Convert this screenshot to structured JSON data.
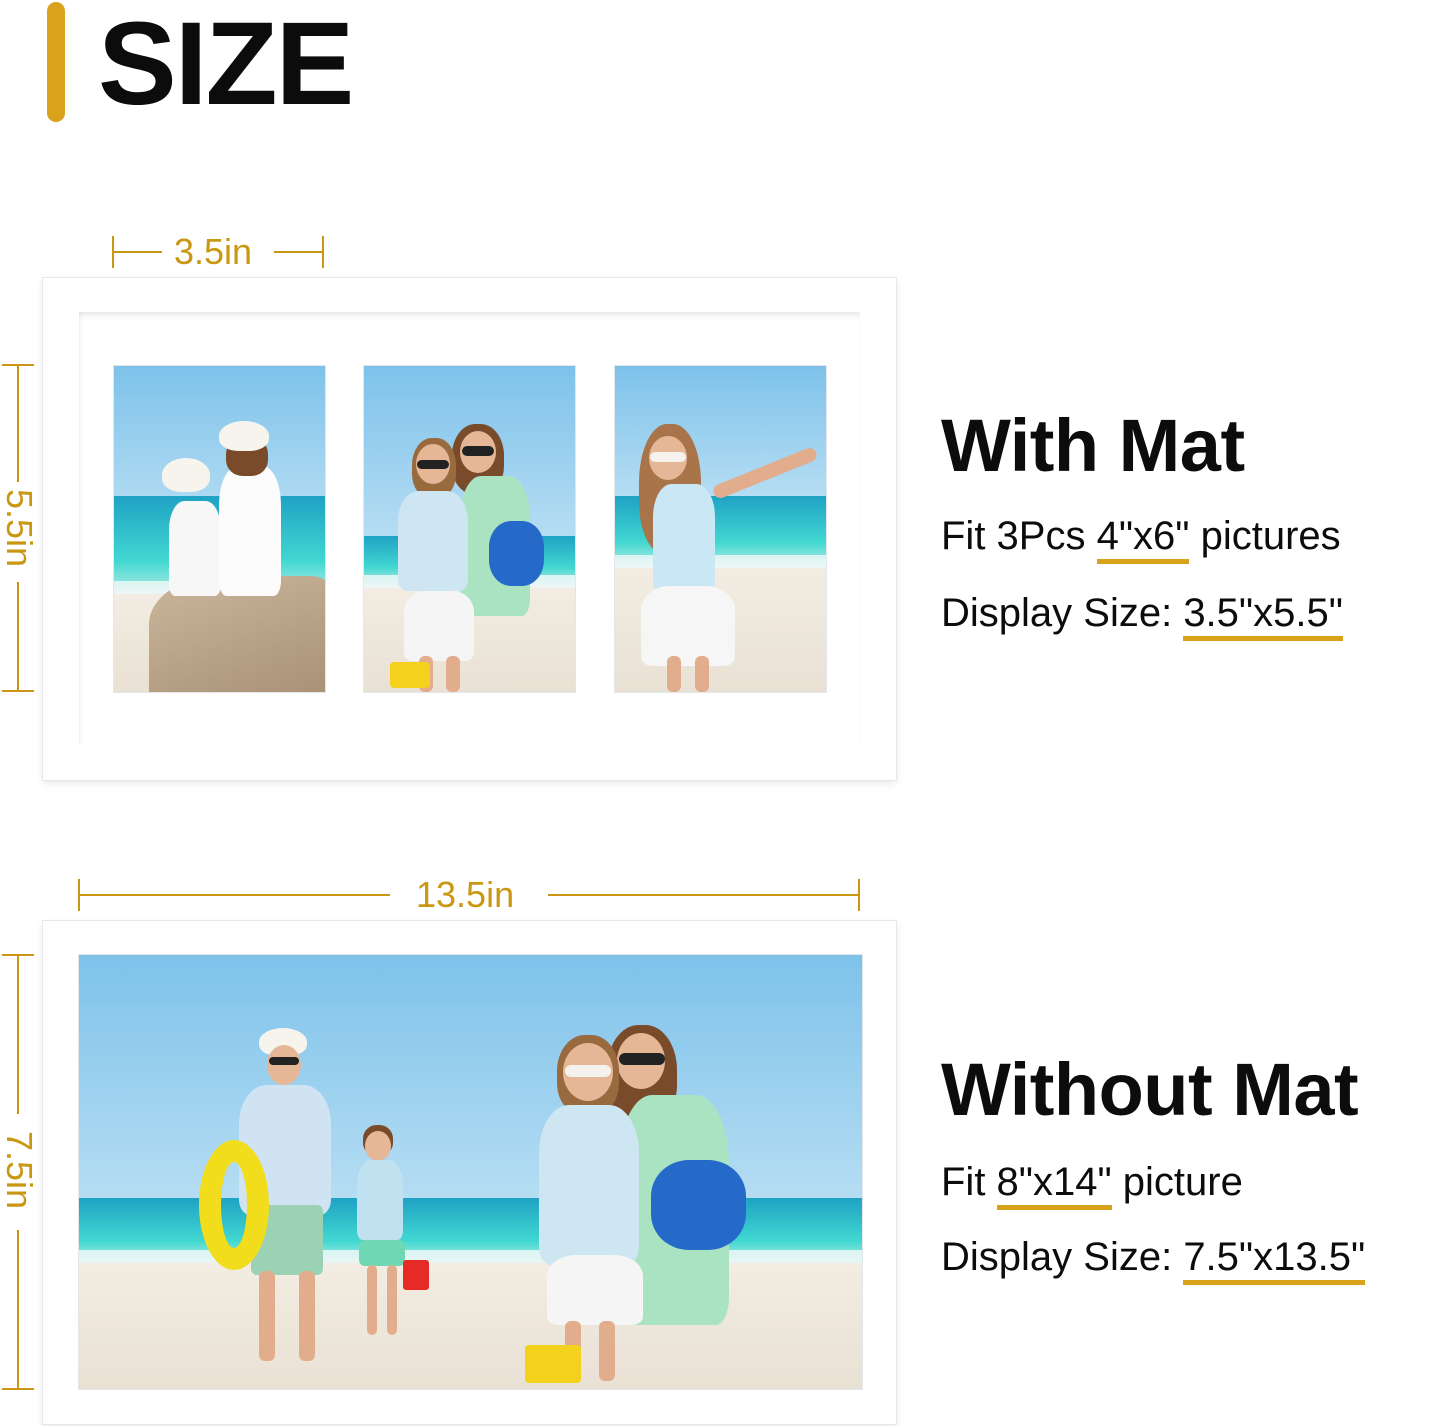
{
  "header": {
    "title": "SIZE"
  },
  "with_mat": {
    "width_label": "3.5in",
    "height_label": "5.5in",
    "heading": "With Mat",
    "fit_prefix": "Fit 3Pcs ",
    "fit_size": "4\"x6\"",
    "fit_suffix": " pictures",
    "display_prefix": "Display Size: ",
    "display_size": "3.5\"x5.5\""
  },
  "without_mat": {
    "width_label": "13.5in",
    "height_label": "7.5in",
    "heading": "Without Mat",
    "fit_prefix": "Fit ",
    "fit_size": "8\"x14\"",
    "fit_suffix": " picture",
    "display_prefix": "Display Size: ",
    "display_size": "7.5\"x13.5\""
  },
  "colors": {
    "accent": "#d9a21b",
    "dimension": "#c99712",
    "text": "#0c0c0c",
    "frame": "#ffffff"
  }
}
